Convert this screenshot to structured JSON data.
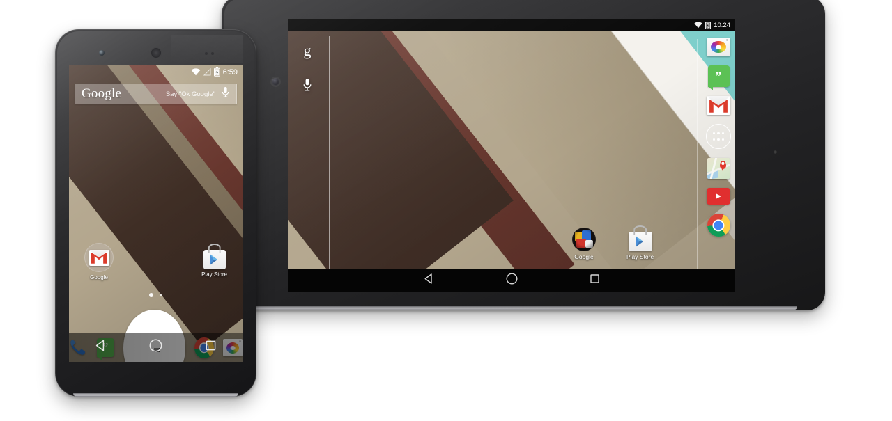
{
  "scene": {
    "title": "Android L preview on Nexus 5 phone and Nexus 7 tablet",
    "background": "#ffffff"
  },
  "wallpaper": {
    "name": "android-l-default-wallpaper",
    "colors": {
      "teal": "#7ecfcb",
      "white_band": "#f3f1ec",
      "light_tan": "#c3b9a4",
      "tan": "#b0a287",
      "mid_brown": "#8b7a63",
      "dark_brown": "#4f3b31",
      "maroon": "#6d3c32",
      "deep_brown": "#3a2a23"
    }
  },
  "phone": {
    "device_name": "nexus-5",
    "status_bar": {
      "wifi_icon": "wifi-icon",
      "signal_icon": "signal-triangle-icon",
      "battery_icon": "battery-charging-icon",
      "time": "6:59"
    },
    "search_bar": {
      "logo_text": "Google",
      "hint_text": "Say \"Ok Google\"",
      "mic_icon": "microphone-icon"
    },
    "home_apps": [
      {
        "label": "Google",
        "icon": "google-folder-icon"
      },
      {
        "label": "Play Store",
        "icon": "play-store-icon"
      }
    ],
    "page_indicator": {
      "pages": 2,
      "current": 1
    },
    "dock": [
      {
        "label": "Phone",
        "icon": "phone-dialer-icon"
      },
      {
        "label": "Hangouts",
        "icon": "hangouts-icon"
      },
      {
        "label": "Apps",
        "icon": "all-apps-icon"
      },
      {
        "label": "Chrome",
        "icon": "chrome-icon"
      },
      {
        "label": "Camera",
        "icon": "camera-icon"
      }
    ],
    "nav_bar": [
      {
        "label": "Back",
        "icon": "back-triangle-icon"
      },
      {
        "label": "Home",
        "icon": "home-circle-icon"
      },
      {
        "label": "Recents",
        "icon": "recents-square-icon"
      }
    ]
  },
  "tablet": {
    "device_name": "nexus-7",
    "status_bar": {
      "wifi_icon": "wifi-icon",
      "battery_icon": "battery-charging-icon",
      "time": "10:24"
    },
    "search_column": [
      {
        "label": "Google Search",
        "icon": "google-g-icon",
        "glyph": "g"
      },
      {
        "label": "Voice Search",
        "icon": "microphone-icon"
      }
    ],
    "home_apps": [
      {
        "label": "Google",
        "icon": "google-folder-icon"
      },
      {
        "label": "Play Store",
        "icon": "play-store-icon"
      }
    ],
    "dock": [
      {
        "label": "Camera",
        "icon": "camera-icon"
      },
      {
        "label": "Hangouts",
        "icon": "hangouts-icon"
      },
      {
        "label": "Gmail",
        "icon": "gmail-icon"
      },
      {
        "label": "Apps",
        "icon": "all-apps-icon"
      },
      {
        "label": "Maps",
        "icon": "maps-icon"
      },
      {
        "label": "YouTube",
        "icon": "youtube-icon"
      },
      {
        "label": "Chrome",
        "icon": "chrome-icon"
      }
    ],
    "nav_bar": [
      {
        "label": "Back",
        "icon": "back-triangle-icon"
      },
      {
        "label": "Home",
        "icon": "home-circle-icon"
      },
      {
        "label": "Recents",
        "icon": "recents-square-icon"
      }
    ]
  }
}
